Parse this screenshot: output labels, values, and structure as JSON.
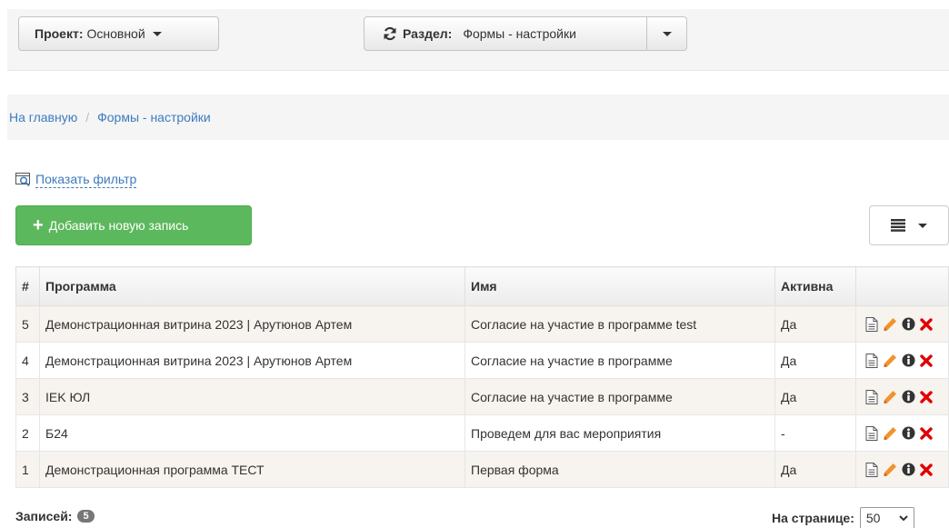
{
  "topbar": {
    "project_label": "Проект:",
    "project_value": "Основной",
    "section_label": "Раздел:",
    "section_value": "Формы - настройки"
  },
  "breadcrumb": {
    "home": "На главную",
    "separator": "/",
    "current": "Формы - настройки"
  },
  "filter": {
    "label": "Показать фильтр"
  },
  "add_button": {
    "label": "Добавить новую запись"
  },
  "table": {
    "headers": [
      "#",
      "Программа",
      "Имя",
      "Активна",
      ""
    ],
    "rows": [
      {
        "num": "5",
        "program": "Демонстрационная витрина 2023 | Арутюнов Артем",
        "name": "Согласие на участие в программе test",
        "active": "Да"
      },
      {
        "num": "4",
        "program": "Демонстрационная витрина 2023 | Арутюнов Артем",
        "name": "Согласие на участие в программе",
        "active": "Да"
      },
      {
        "num": "3",
        "program": "IEK ЮЛ",
        "name": "Согласие на участие в программе",
        "active": "Да"
      },
      {
        "num": "2",
        "program": "Б24",
        "name": "Проведем для вас мероприятия",
        "active": "-"
      },
      {
        "num": "1",
        "program": "Демонстрационная программа ТЕСТ",
        "name": "Первая форма",
        "active": "Да"
      }
    ],
    "row_actions": [
      "document-icon",
      "pencil-icon",
      "info-icon",
      "delete-icon"
    ]
  },
  "footer": {
    "records_label": "Записей:",
    "records_count": "5",
    "per_page_label": "На странице:",
    "per_page_value": "50"
  },
  "colors": {
    "link": "#3c7bbd",
    "success": "#5cb85c",
    "pencil": "#f0932b",
    "delete": "#e00000",
    "odd_row": "#f7f3ee"
  }
}
